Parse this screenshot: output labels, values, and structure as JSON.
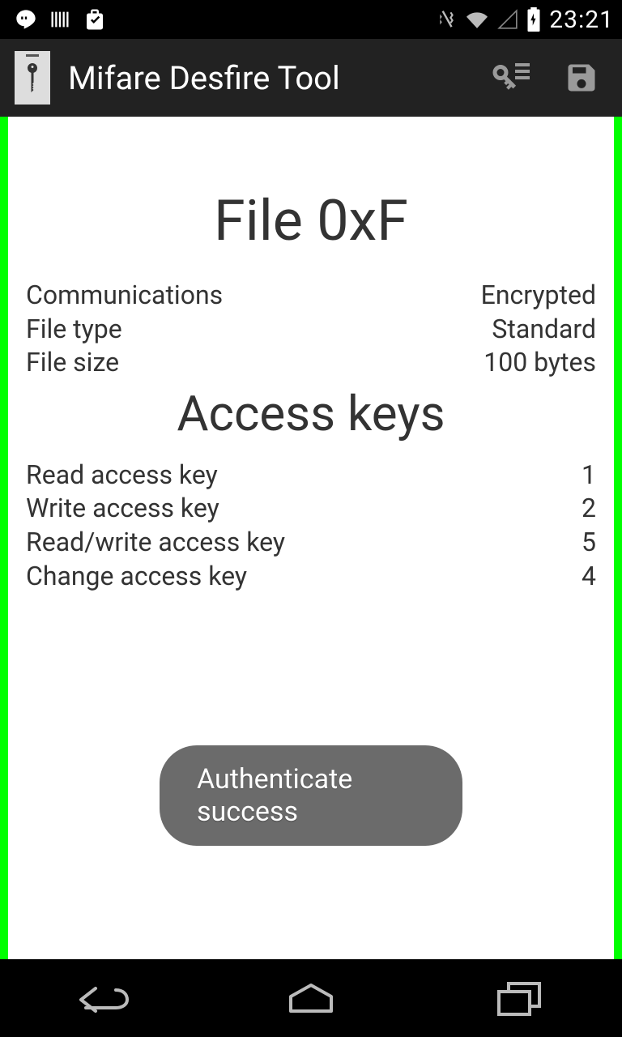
{
  "status": {
    "time": "23:21"
  },
  "actionbar": {
    "title": "Mifare Desfire Tool"
  },
  "page": {
    "file_title": "File 0xF",
    "info": {
      "communications_label": "Communications",
      "communications_value": "Encrypted",
      "file_type_label": "File type",
      "file_type_value": "Standard",
      "file_size_label": "File size",
      "file_size_value": "100 bytes"
    },
    "access_title": "Access keys",
    "access": {
      "read_label": "Read access key",
      "read_value": "1",
      "write_label": "Write access key",
      "write_value": "2",
      "rw_label": "Read/write access key",
      "rw_value": "5",
      "change_label": "Change access key",
      "change_value": "4"
    }
  },
  "toast": {
    "message": "Authenticate success"
  }
}
